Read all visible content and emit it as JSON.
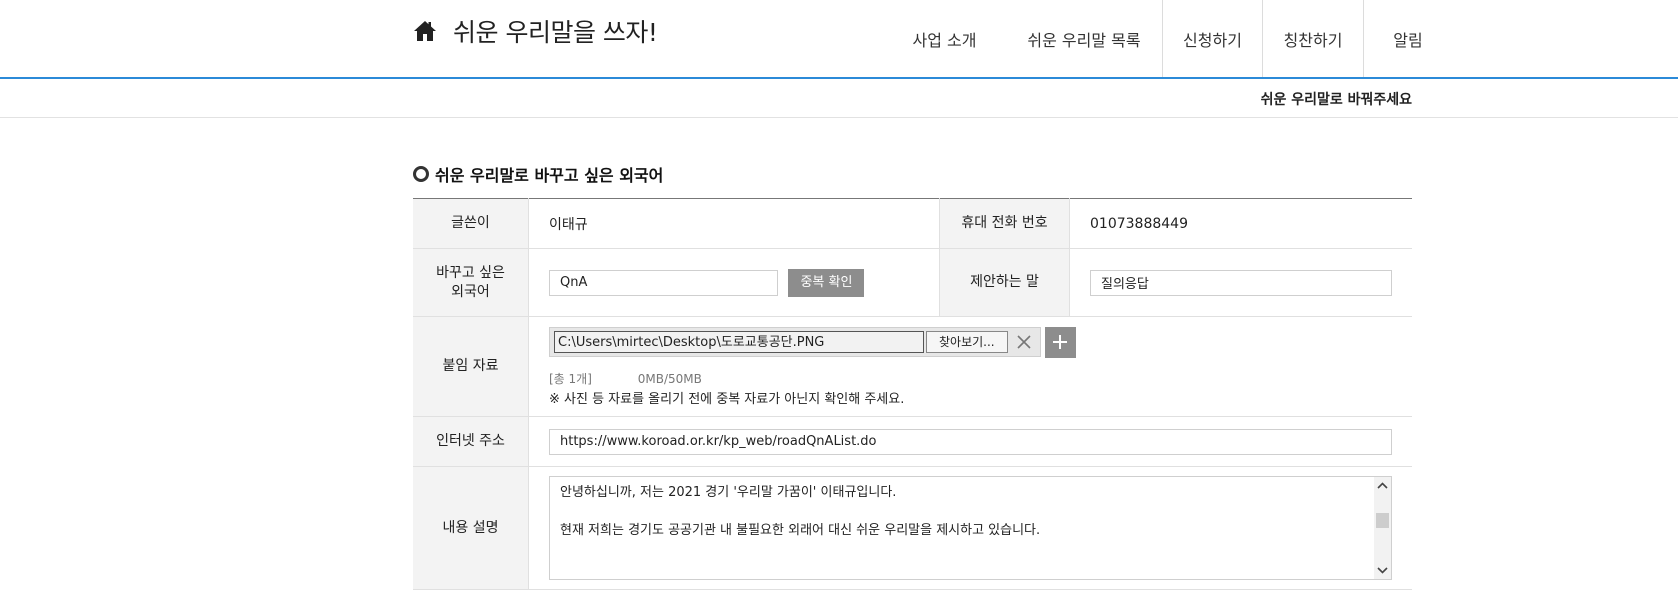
{
  "site": {
    "title": "쉬운 우리말을 쓰자!"
  },
  "nav": {
    "items": [
      "사업 소개",
      "쉬운 우리말 목록",
      "신청하기",
      "칭찬하기",
      "알림"
    ]
  },
  "breadcrumb": "쉬운 우리말로 바꿔주세요",
  "section": {
    "title": "쉬운 우리말로 바꾸고 싶은 외국어"
  },
  "form": {
    "writer_label": "글쓴이",
    "writer_value": "이태규",
    "phone_label": "휴대 전화 번호",
    "phone_value": "01073888449",
    "foreign_label_line1": "바꾸고 싶은",
    "foreign_label_line2": "외국어",
    "foreign_value": "QnA",
    "dup_check_label": "중복 확인",
    "suggest_label": "제안하는 말",
    "suggest_value": "질의응답",
    "attach_label": "붙임 자료",
    "file_path": "C:\\Users\\mirtec\\Desktop\\도로교통공단.PNG",
    "browse_label": "찾아보기...",
    "file_count": "[총 1개]",
    "file_size": "0MB/50MB",
    "file_note": "※ 사진 등 자료를 올리기 전에 중복 자료가 아닌지 확인해 주세요.",
    "url_label": "인터넷 주소",
    "url_value": "https://www.koroad.or.kr/kp_web/roadQnAList.do",
    "desc_label": "내용 설명",
    "desc_line1": "안녕하십니까, 저는 2021 경기 '우리말 가꿈이' 이태규입니다.",
    "desc_line2": "현재 저희는 경기도 공공기관 내 불필요한 외래어 대신 쉬운 우리말을 제시하고 있습니다."
  },
  "colors": {
    "accent": "#2b8ad8",
    "button_gray": "#8d8d8d"
  },
  "icons": [
    "home-icon",
    "ring-bullet-icon",
    "close-icon",
    "plus-icon",
    "scroll-up-icon",
    "scroll-down-icon"
  ]
}
